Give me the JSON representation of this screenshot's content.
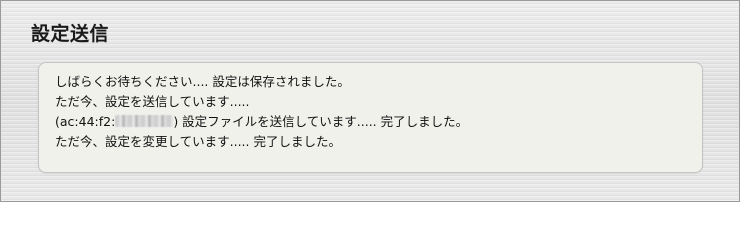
{
  "page": {
    "title": "設定送信"
  },
  "messages": {
    "line1": "しばらくお待ちください.... 設定は保存されました。",
    "line2": "ただ今、設定を送信しています.....",
    "line3_prefix": "(ac:44:f2:",
    "line3_suffix": ") 設定ファイルを送信しています..... 完了しました。",
    "line4": "ただ今、設定を変更しています..... 完了しました。"
  }
}
